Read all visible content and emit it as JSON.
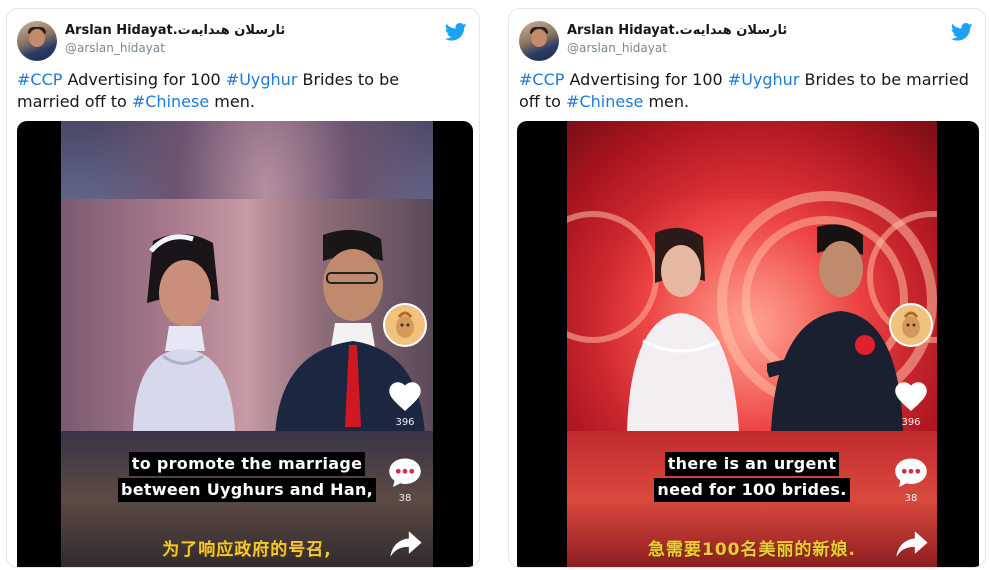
{
  "tweets": [
    {
      "author_name": "Arslan Hidayat.ئارسلان ھىدايەت",
      "author_handle": "@arslan_hidayat",
      "text_parts": [
        {
          "t": "#CCP",
          "tag": true
        },
        {
          "t": " Advertising for 100 ",
          "tag": false
        },
        {
          "t": "#Uyghur",
          "tag": true
        },
        {
          "t": " Brides to be married off to ",
          "tag": false
        },
        {
          "t": "#Chinese",
          "tag": true
        },
        {
          "t": " men.",
          "tag": false
        }
      ],
      "caption_lines": [
        "to promote the marriage",
        "between  Uyghurs and Han,"
      ],
      "chinese_caption": "为了响应政府的号召,",
      "like_count": "396",
      "comment_count": "38"
    },
    {
      "author_name": "Arslan Hidayat.ئارسلان ھىدايەت",
      "author_handle": "@arslan_hidayat",
      "text_parts": [
        {
          "t": "#CCP",
          "tag": true
        },
        {
          "t": " Advertising for 100 ",
          "tag": false
        },
        {
          "t": "#Uyghur",
          "tag": true
        },
        {
          "t": " Brides to be married off to ",
          "tag": false
        },
        {
          "t": "#Chinese",
          "tag": true
        },
        {
          "t": " men.",
          "tag": false
        }
      ],
      "caption_lines": [
        "there is an urgent",
        "need for 100 brides."
      ],
      "chinese_caption": "急需要100名美丽的新娘.",
      "like_count": "396",
      "comment_count": "38"
    }
  ],
  "icons": {
    "brand": "twitter-bird-icon",
    "like": "heart-icon",
    "comment": "comment-icon",
    "share": "share-arrow-icon",
    "creator": "creator-avatar-icon"
  },
  "colors": {
    "hashtag": "#1d7bd8",
    "twitter_blue": "#1da1f2",
    "chinese_caption": "#f0c83a"
  }
}
